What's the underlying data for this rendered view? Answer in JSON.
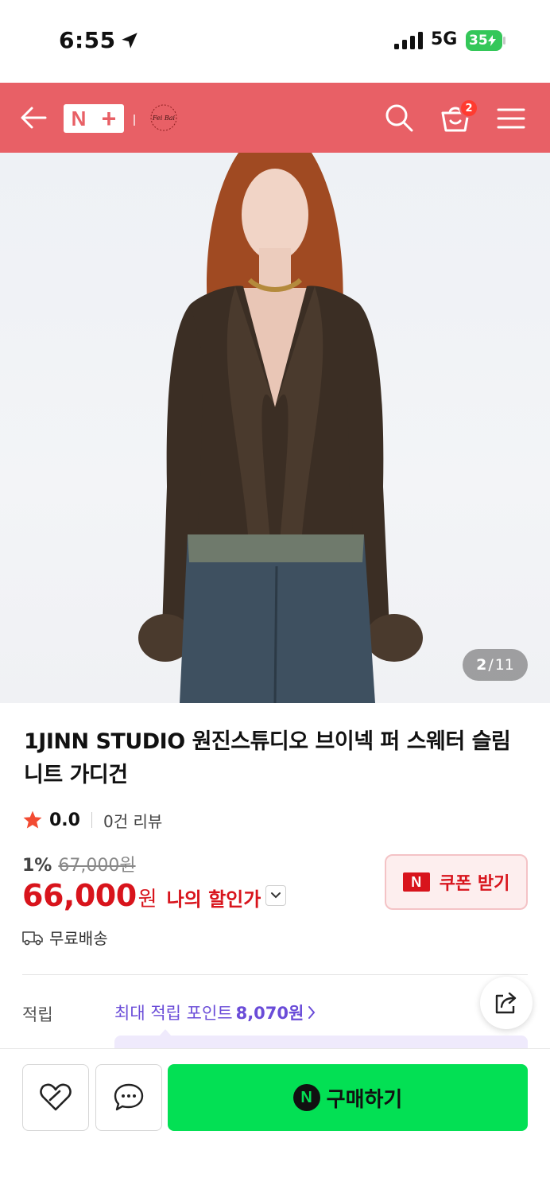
{
  "status_bar": {
    "time": "6:55",
    "network": "5G",
    "battery": "35"
  },
  "header": {
    "logo_n": "N",
    "logo_plus": "+",
    "store_logo_text": "Fei Bai",
    "cart_count": "2",
    "icons": [
      "back-arrow-icon",
      "search-icon",
      "cart-icon",
      "menu-icon"
    ],
    "background_color": "#e86066"
  },
  "gallery": {
    "current": "2",
    "separator": "/",
    "total": "11"
  },
  "product": {
    "title": "1JINN STUDIO 원진스튜디오 브이넥 퍼 스웨터 슬림 니트 가디건",
    "rating": "0.0",
    "review_count": "0건 리뷰",
    "discount_rate": "1%",
    "original_price": "67,000원",
    "price": "66,000",
    "price_unit": "원",
    "my_discount_label": "나의 할인가",
    "coupon_badge": "N",
    "coupon_label": "쿠폰 받기",
    "shipping": "무료배송"
  },
  "points": {
    "label": "적립",
    "text_prefix": "최대 적립 포인트 ",
    "amount": "8,070원"
  },
  "bottom_bar": {
    "buy_badge": "N",
    "buy_label": "구매하기"
  },
  "colors": {
    "accent_red": "#d8141c",
    "buy_green": "#03e054",
    "points_purple": "#6a4cd8"
  }
}
